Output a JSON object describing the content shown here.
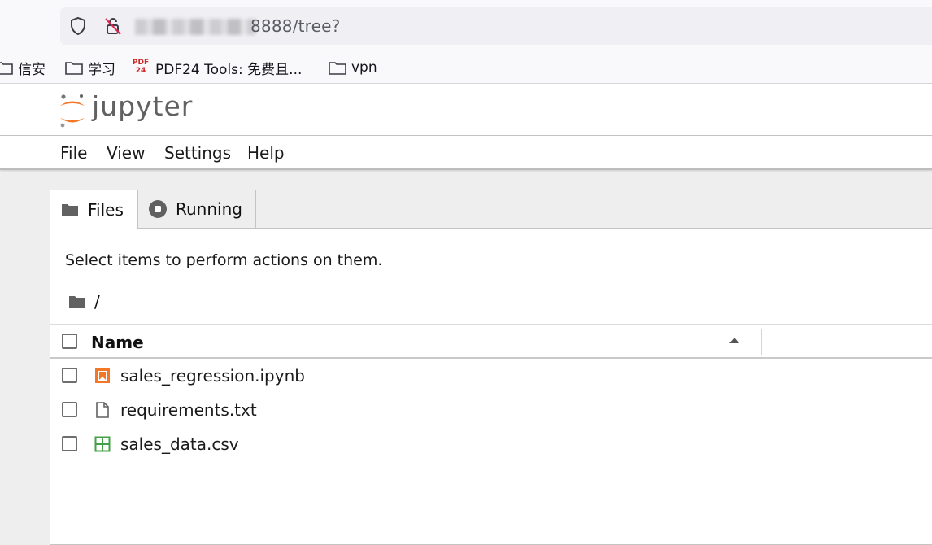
{
  "browser": {
    "url_suffix": "8888/tree?",
    "bookmarks": [
      {
        "label": "信安",
        "icon": "folder-icon"
      },
      {
        "label": "学习",
        "icon": "folder-icon"
      },
      {
        "label": "PDF24 Tools: 免费且...",
        "icon": "pdf24-icon"
      },
      {
        "label": "vpn",
        "icon": "folder-icon"
      }
    ]
  },
  "app": {
    "wordmark": "jupyter",
    "accent_color": "#f37726",
    "menu": [
      "File",
      "View",
      "Settings",
      "Help"
    ]
  },
  "tabs": [
    {
      "label": "Files",
      "icon": "folder-icon",
      "active": true
    },
    {
      "label": "Running",
      "icon": "stop-circle-icon",
      "active": false
    }
  ],
  "browser_panel": {
    "hint": "Select items to perform actions on them.",
    "breadcrumb": "/",
    "column_name": "Name",
    "sort": "ascending",
    "files": [
      {
        "name": "sales_regression.ipynb",
        "icon": "notebook-icon"
      },
      {
        "name": "requirements.txt",
        "icon": "text-file-icon"
      },
      {
        "name": "sales_data.csv",
        "icon": "spreadsheet-icon"
      }
    ]
  }
}
